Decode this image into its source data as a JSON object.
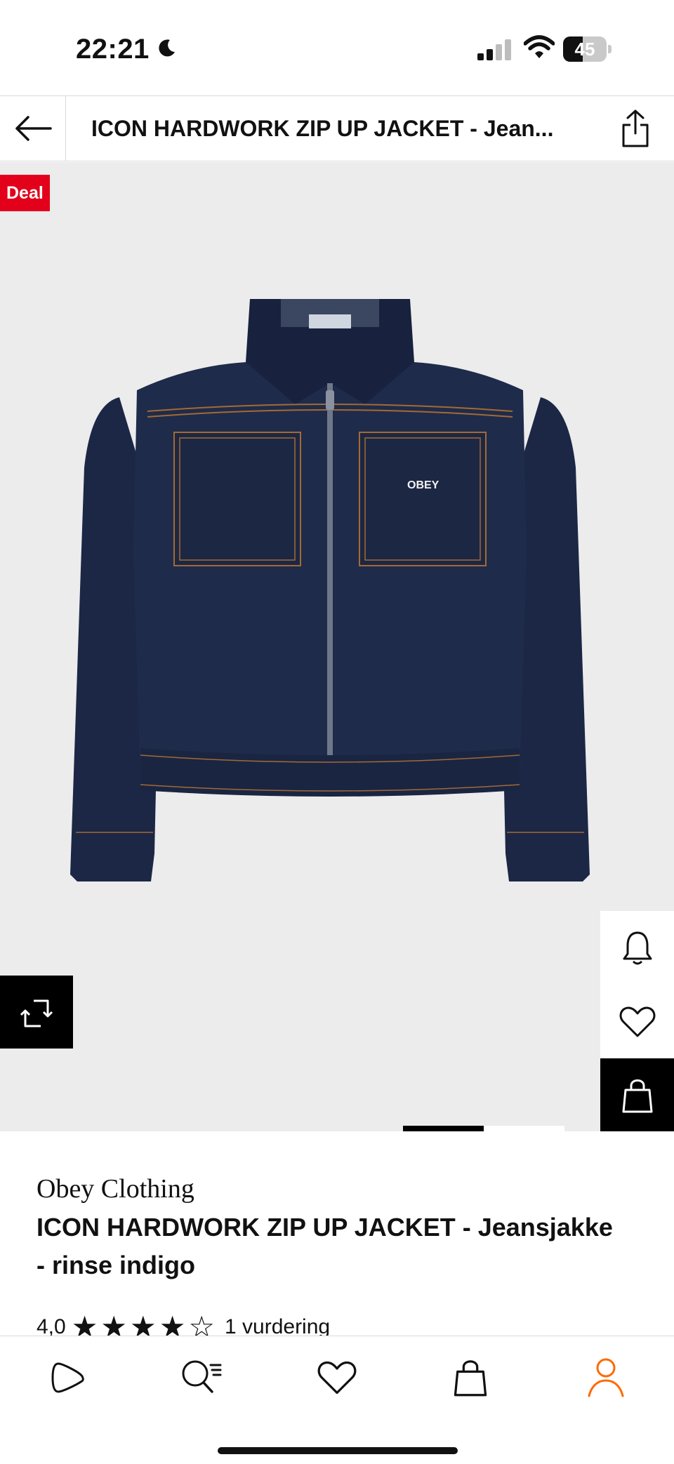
{
  "status_bar": {
    "time": "22:21",
    "battery": "45",
    "battery_level": 0.45
  },
  "header": {
    "title": "ICON HARDWORK ZIP UP JACKET - Jean...",
    "back_icon": "arrow-left-icon",
    "share_icon": "share-icon"
  },
  "gallery": {
    "badge": "Deal",
    "logo_text": "OBEY",
    "image_count": 2,
    "active_index": 0,
    "compare_icon": "compare-icon",
    "actions": [
      "bell-icon",
      "heart-icon",
      "bag-icon"
    ]
  },
  "product": {
    "brand": "Obey Clothing",
    "title": "ICON HARDWORK ZIP UP JACKET - Jeansjakke - rinse indigo",
    "rating": {
      "score": "4,0",
      "filled_stars": 4,
      "total_stars": 5,
      "count_text": "1 vurdering"
    }
  },
  "tab_bar": {
    "items": [
      "home-icon",
      "search-icon",
      "wishlist-icon",
      "cart-icon",
      "profile-icon"
    ],
    "active": "profile-icon"
  },
  "colors": {
    "accent": "#e2001a",
    "active_tab": "#ff6900",
    "denim": "#1f2b4a",
    "stitch": "#b7793a",
    "image_bg": "#ececec"
  }
}
